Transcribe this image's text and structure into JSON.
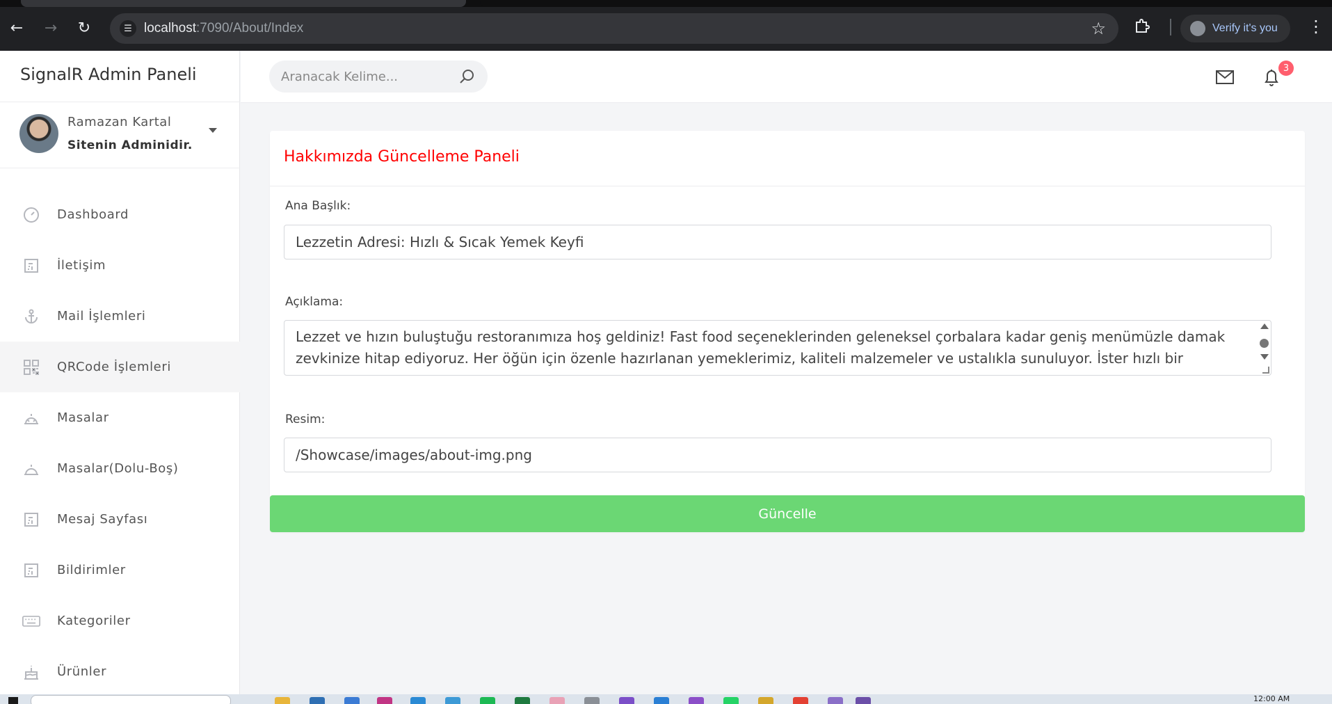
{
  "browser": {
    "url_host": "localhost",
    "url_path": ":7090/About/Index",
    "profile_chip": "Verify it's you"
  },
  "sidebar": {
    "brand": "SignalR Admin Paneli",
    "profile": {
      "name": "Ramazan Kartal",
      "role": "Sitenin Adminidir."
    },
    "items": [
      {
        "label": "Dashboard",
        "icon": "speedometer-icon"
      },
      {
        "label": "İletişim",
        "icon": "table-icon"
      },
      {
        "label": "Mail İşlemleri",
        "icon": "anchor-icon"
      },
      {
        "label": "QRCode İşlemleri",
        "icon": "qrcode-icon"
      },
      {
        "label": "Masalar",
        "icon": "table-bell-icon"
      },
      {
        "label": "Masalar(Dolu-Boş)",
        "icon": "table-bell-icon"
      },
      {
        "label": "Mesaj Sayfası",
        "icon": "table-icon"
      },
      {
        "label": "Bildirimler",
        "icon": "table-icon"
      },
      {
        "label": "Kategoriler",
        "icon": "keyboard-icon"
      },
      {
        "label": "Ürünler",
        "icon": "cake-icon"
      }
    ]
  },
  "topbar": {
    "search_placeholder": "Aranacak Kelime...",
    "notification_count": "3"
  },
  "form": {
    "title": "Hakkımızda Güncelleme Paneli",
    "title_label": "Ana Başlık:",
    "title_value": "Lezzetin Adresi: Hızlı & Sıcak Yemek Keyfi",
    "description_label": "Açıklama:",
    "description_value": "Lezzet ve hızın buluştuğu restoranımıza hoş geldiniz! Fast food seçeneklerinden geleneksel çorbalara kadar geniş menümüzle damak zevkinize hitap ediyoruz. Her öğün için özenle hazırlanan yemeklerimiz, kaliteli malzemeler ve ustalıkla sunuluyor. İster hızlı bir atıştırmalık",
    "image_label": "Resim:",
    "image_value": "/Showcase/images/about-img.png",
    "submit_label": "Güncelle"
  },
  "taskbar": {
    "clock": "12:00 AM"
  },
  "colors": {
    "title_red": "#ff0000",
    "button_green": "#6bd774",
    "badge_red": "#ff5e6d"
  }
}
